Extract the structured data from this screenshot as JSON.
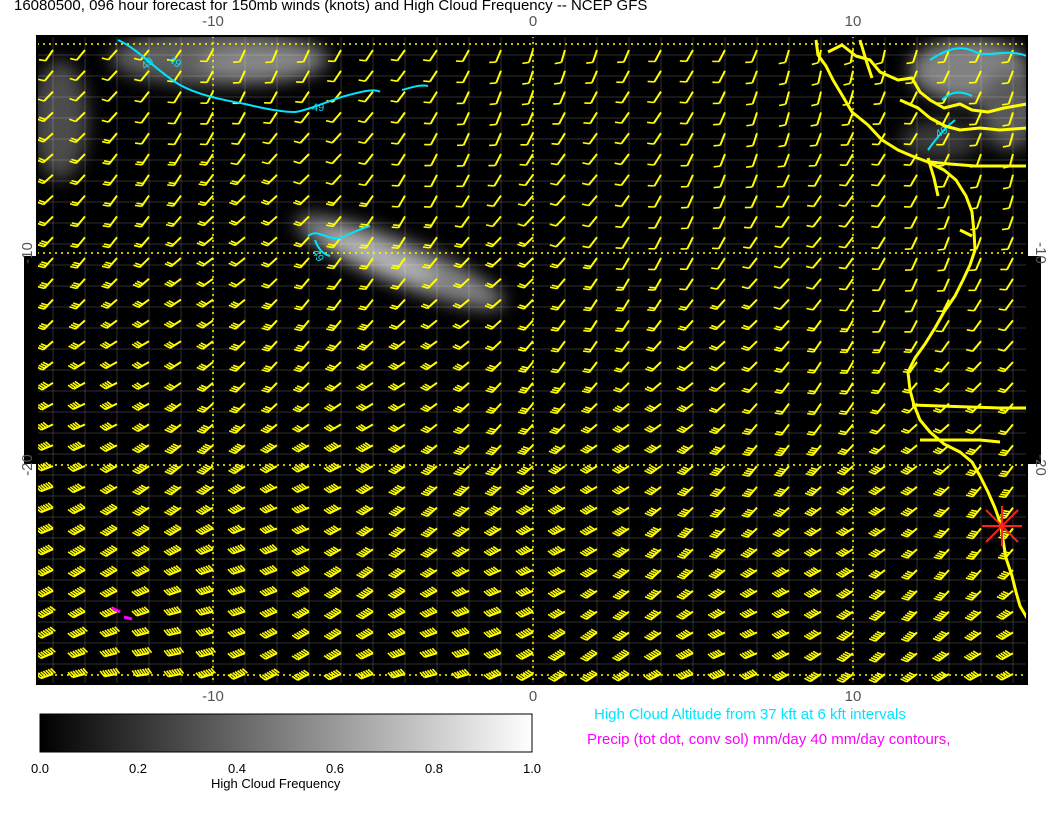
{
  "title": "16080500, 096 hour forecast for 150mb winds (knots) and High Cloud Frequency -- NCEP GFS",
  "map": {
    "lon_ticks": [
      "-10",
      "0",
      "10"
    ],
    "lat_ticks": [
      "-10",
      "-20"
    ],
    "contour_labels": [
      "49",
      "49",
      "49",
      "49",
      "49"
    ],
    "background_color": "#000000",
    "grid_color": "#ffff00",
    "barb_color": "#ffff00",
    "coast_color": "#ffff00",
    "contour_color": "#00ffff",
    "marker_color": "#ff0000",
    "precip_color": "#ff00ff"
  },
  "legend": {
    "cyan_note": "High Cloud Altitude from 37 kft at 6 kft intervals",
    "cyan_color": "#00e5ff",
    "magenta_note": "Precip (tot dot, conv sol) mm/day 40 mm/day contours,",
    "magenta_color": "#ff00ff"
  },
  "colorbar": {
    "title": "High Cloud Frequency",
    "ticks": [
      "0.0",
      "0.2",
      "0.4",
      "0.6",
      "0.8",
      "1.0"
    ],
    "range": [
      0.0,
      1.0
    ]
  }
}
